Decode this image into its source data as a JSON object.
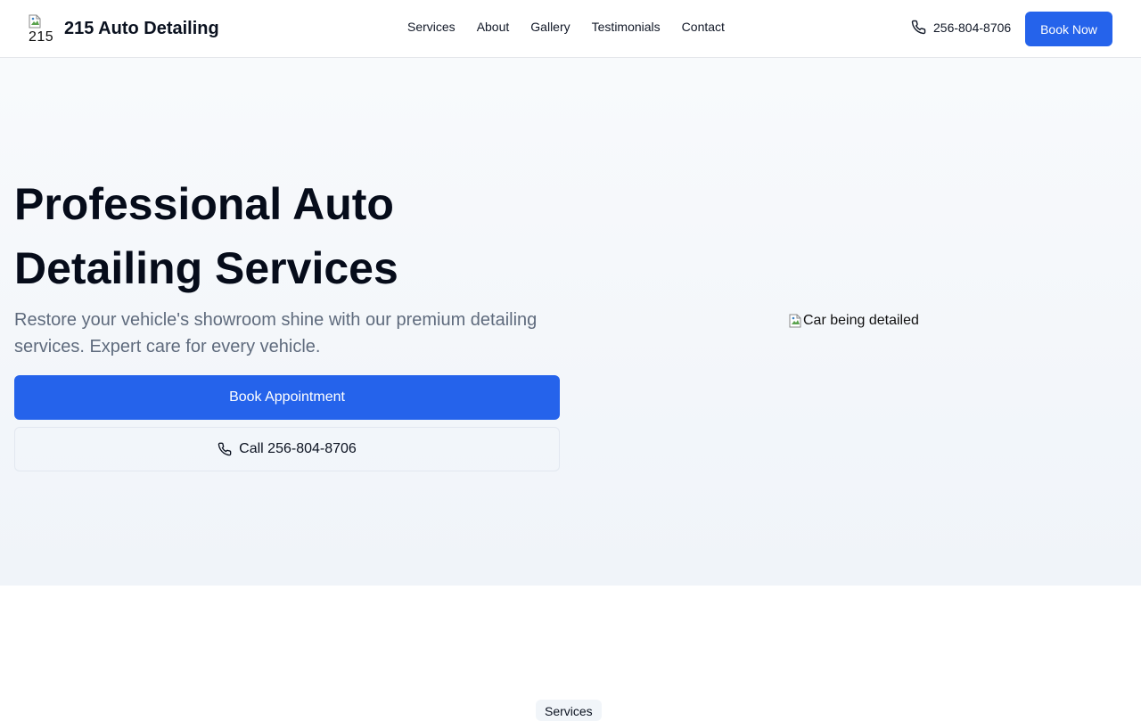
{
  "brand": {
    "logo_alt": "215",
    "name": "215 Auto Detailing"
  },
  "nav": {
    "items": [
      {
        "label": "Services"
      },
      {
        "label": "About"
      },
      {
        "label": "Gallery"
      },
      {
        "label": "Testimonials"
      },
      {
        "label": "Contact"
      }
    ],
    "phone": "256-804-8706",
    "book_now": "Book Now"
  },
  "hero": {
    "title": "Professional Auto Detailing Services",
    "subtitle": "Restore your vehicle's showroom shine with our premium detailing services. Expert care for every vehicle.",
    "primary_cta": "Book Appointment",
    "secondary_cta": "Call 256-804-8706",
    "image_alt": "Car being detailed"
  },
  "services": {
    "badge": "Services"
  },
  "colors": {
    "accent": "#2563eb",
    "hero_bg": "#f8fafc",
    "muted_text": "#5f6b7d"
  },
  "icons": {
    "phone": "phone-icon",
    "broken_image": "broken-image-icon"
  }
}
